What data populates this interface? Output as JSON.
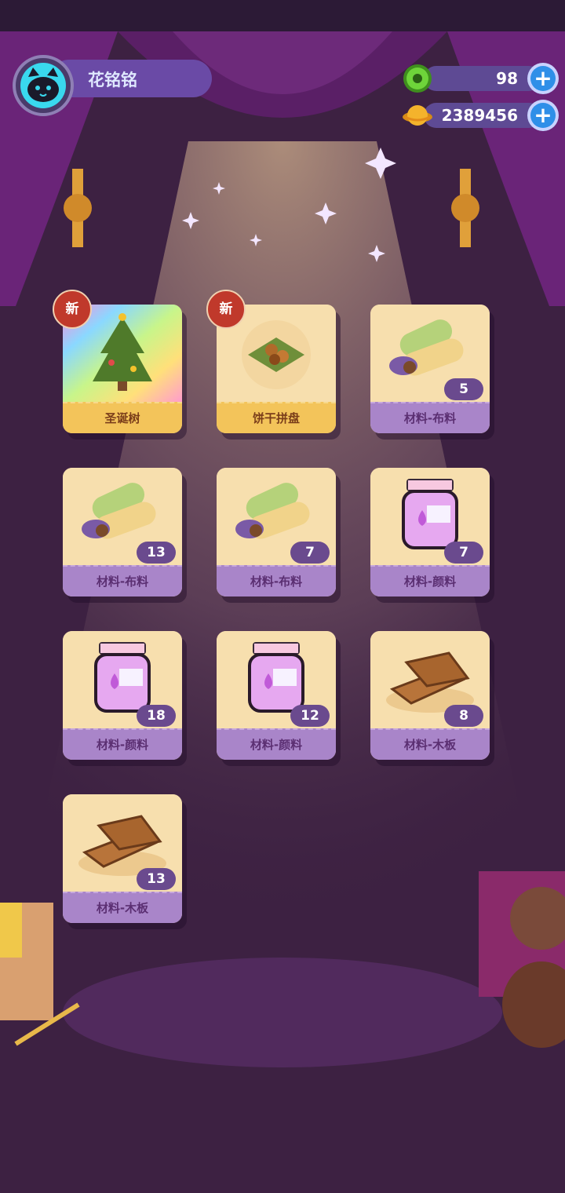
{
  "player": {
    "name": "花铭铭"
  },
  "currencies": [
    {
      "name": "gems",
      "value": "98",
      "color": "#5ec22a"
    },
    {
      "name": "coins",
      "value": "2389456",
      "color": "#f4b32c"
    }
  ],
  "items": [
    {
      "label": "圣诞树",
      "count": "",
      "badge": "新",
      "kind": "tree",
      "special": true
    },
    {
      "label": "饼干拼盘",
      "count": "",
      "badge": "新",
      "kind": "cookies",
      "special": true
    },
    {
      "label": "材料-布料",
      "count": "5",
      "badge": "",
      "kind": "fabric"
    },
    {
      "label": "材料-布料",
      "count": "13",
      "badge": "",
      "kind": "fabric"
    },
    {
      "label": "材料-布料",
      "count": "7",
      "badge": "",
      "kind": "fabric"
    },
    {
      "label": "材料-颜料",
      "count": "7",
      "badge": "",
      "kind": "paint"
    },
    {
      "label": "材料-颜料",
      "count": "18",
      "badge": "",
      "kind": "paint"
    },
    {
      "label": "材料-颜料",
      "count": "12",
      "badge": "",
      "kind": "paint"
    },
    {
      "label": "材料-木板",
      "count": "8",
      "badge": "",
      "kind": "wood"
    },
    {
      "label": "材料-木板",
      "count": "13",
      "badge": "",
      "kind": "wood"
    }
  ],
  "colors": {
    "accent_purple": "#a985c9",
    "card_bg": "#f7dfae",
    "badge_red": "#c0392b"
  }
}
